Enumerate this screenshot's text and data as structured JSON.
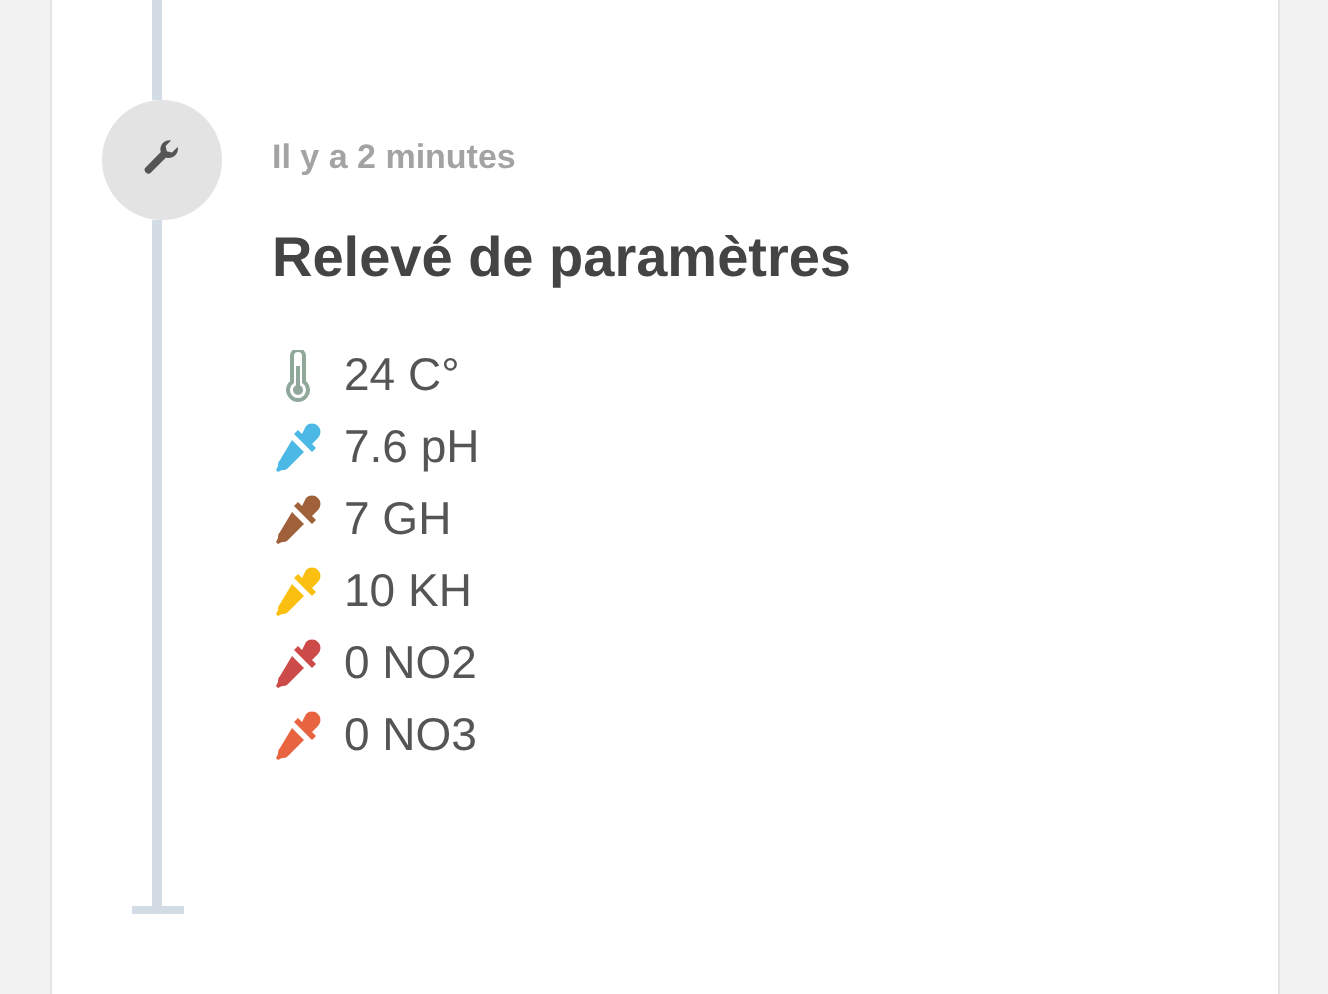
{
  "event": {
    "time": "Il y a 2 minutes",
    "title": "Relevé de paramètres",
    "readings": [
      {
        "kind": "thermometer",
        "color": "#8fa89a",
        "text": "24 C°"
      },
      {
        "kind": "dropper",
        "color": "#4bb8e6",
        "text": "7.6 pH"
      },
      {
        "kind": "dropper",
        "color": "#a0603a",
        "text": "7 GH"
      },
      {
        "kind": "dropper",
        "color": "#fbbf10",
        "text": "10 KH"
      },
      {
        "kind": "dropper",
        "color": "#cc4a48",
        "text": "0 NO2"
      },
      {
        "kind": "dropper",
        "color": "#e8633f",
        "text": "0 NO3"
      }
    ]
  }
}
